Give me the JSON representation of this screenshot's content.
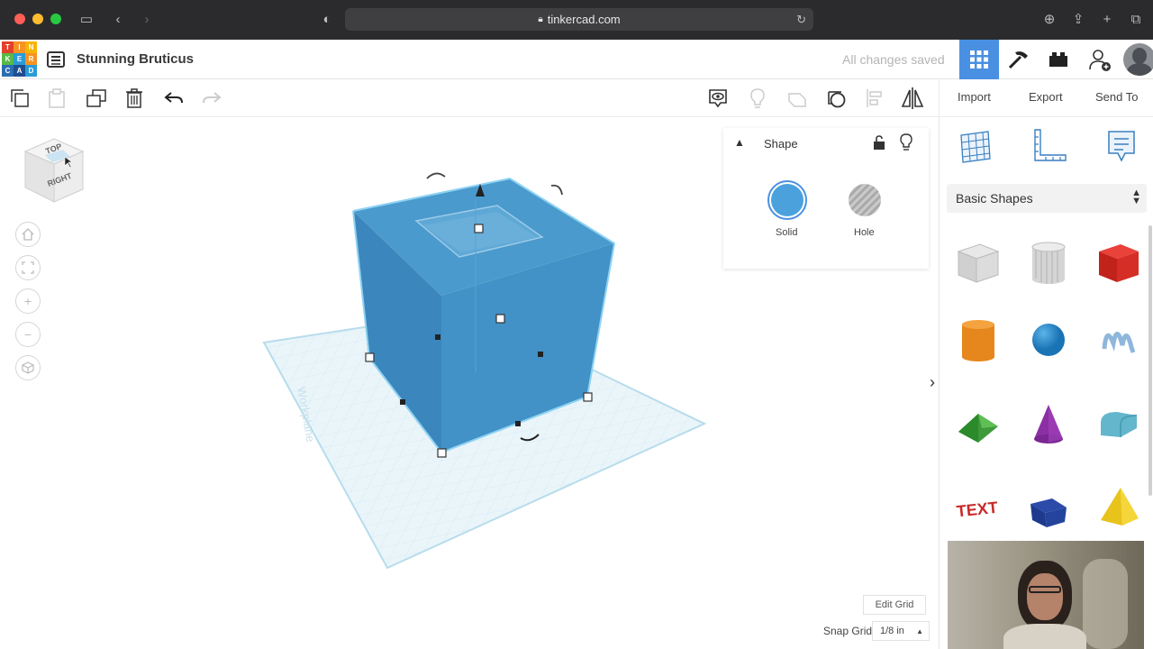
{
  "browser": {
    "url": "tinkercad.com"
  },
  "app": {
    "logo_letters": [
      "T",
      "I",
      "N",
      "K",
      "E",
      "R",
      "C",
      "A",
      "D"
    ],
    "design_title": "Stunning Bruticus",
    "save_status": "All changes saved"
  },
  "toolbar": {
    "import_label": "Import",
    "export_label": "Export",
    "send_to_label": "Send To"
  },
  "viewcube": {
    "top_label": "TOP",
    "right_label": "RIGHT"
  },
  "workplane": {
    "label": "Workplane"
  },
  "shape_panel": {
    "title": "Shape",
    "solid_label": "Solid",
    "hole_label": "Hole"
  },
  "sidebar": {
    "library": "Basic Shapes",
    "shapes": [
      {
        "name": "box-hole"
      },
      {
        "name": "cylinder-hole"
      },
      {
        "name": "box"
      },
      {
        "name": "cylinder"
      },
      {
        "name": "sphere"
      },
      {
        "name": "scribble"
      },
      {
        "name": "roof"
      },
      {
        "name": "cone"
      },
      {
        "name": "round-roof"
      },
      {
        "name": "text"
      },
      {
        "name": "half-sphere"
      },
      {
        "name": "pyramid"
      }
    ],
    "text_shape_label": "TEXT"
  },
  "grid": {
    "edit_grid_label": "Edit Grid",
    "snap_grid_label": "Snap Grid",
    "snap_grid_value": "1/8 in"
  },
  "colors": {
    "accent_blue": "#4a90e2",
    "shape_blue": "#3f8fc4",
    "chrome_dark": "#2b2b2d"
  }
}
